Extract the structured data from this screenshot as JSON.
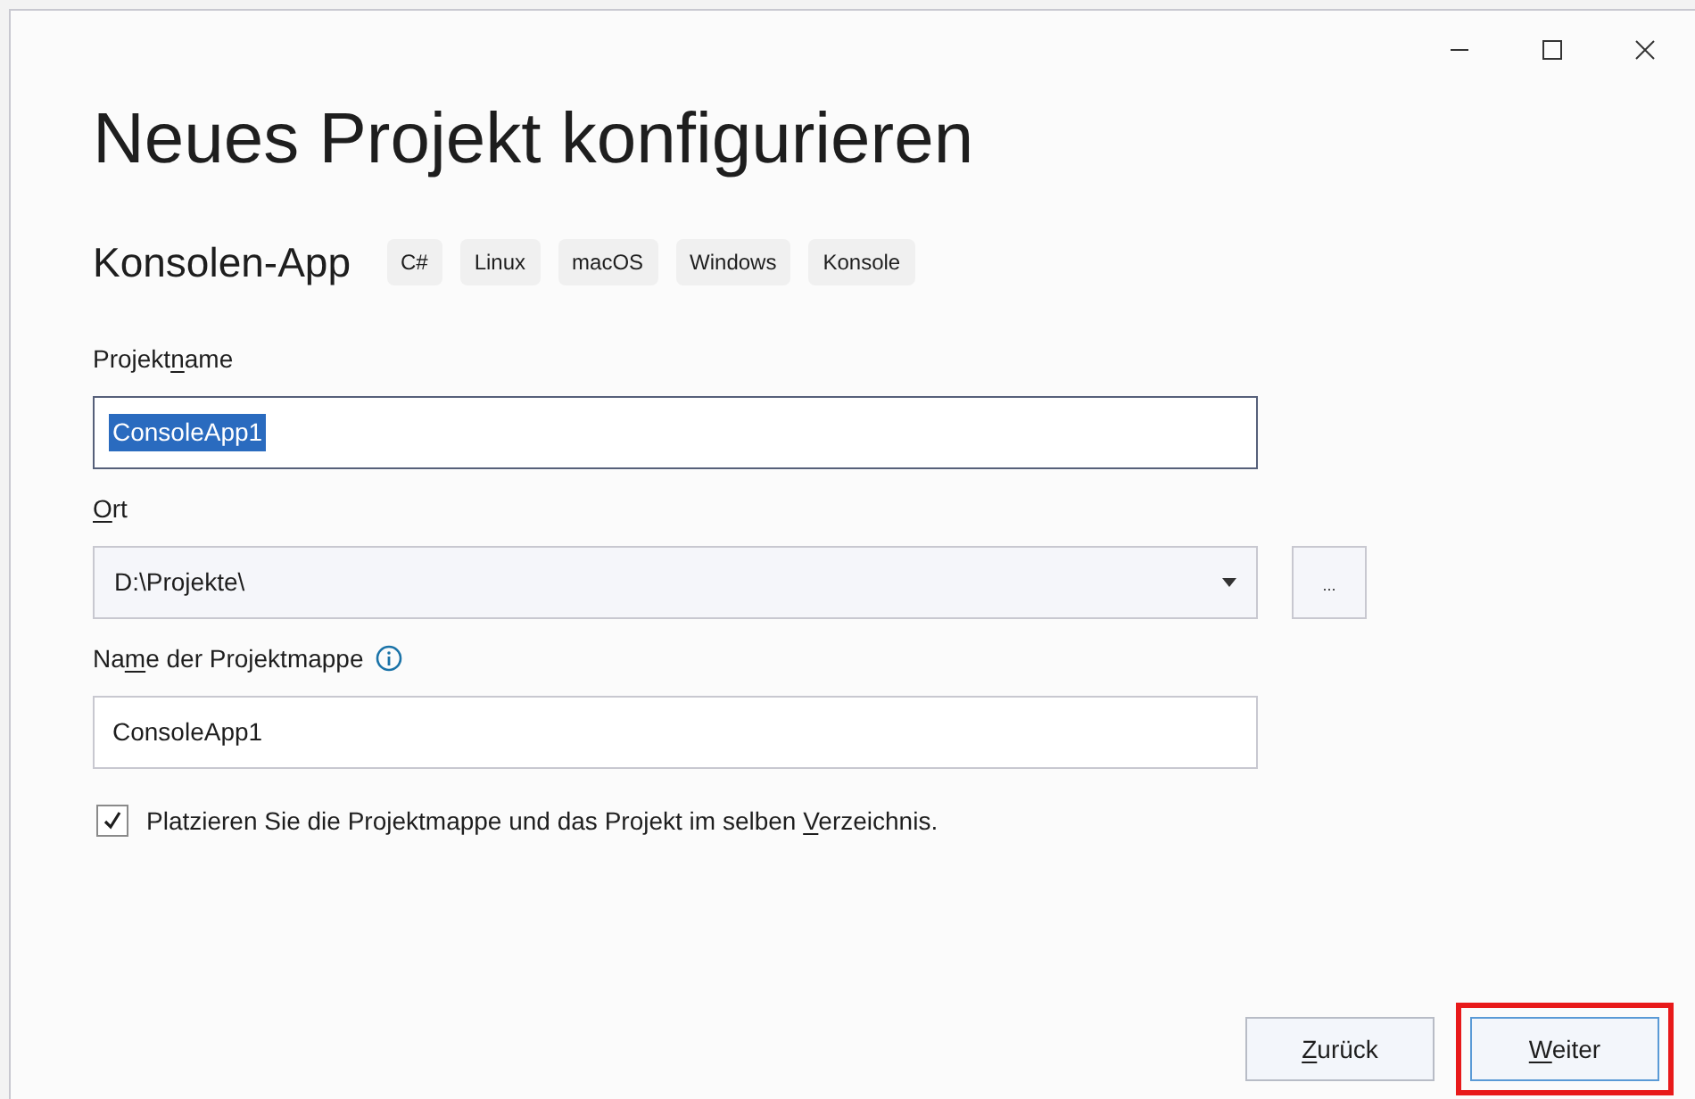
{
  "window": {
    "controls": [
      {
        "kind": "minimize"
      },
      {
        "kind": "maximize"
      },
      {
        "kind": "close"
      }
    ]
  },
  "title": "Neues Projekt konfigurieren",
  "template": {
    "name": "Konsolen-App",
    "tags": [
      "C#",
      "Linux",
      "macOS",
      "Windows",
      "Konsole"
    ]
  },
  "fields": [
    {
      "kind": "text",
      "label": {
        "before": "Projekt",
        "key": "n",
        "after": "ame"
      },
      "value": "ConsoleApp1",
      "text_selected": true,
      "info": false
    },
    {
      "kind": "combo",
      "label": {
        "key": "O",
        "after": "rt"
      },
      "value": "D:\\Projekte\\",
      "browse": "...",
      "info": false
    },
    {
      "kind": "text",
      "label": {
        "before": "Na",
        "key": "m",
        "after": "e der Projektmappe"
      },
      "value": "ConsoleApp1",
      "text_selected": false,
      "info": true
    }
  ],
  "checkbox": {
    "label": {
      "before": "Platzieren Sie die Projektmappe und das Projekt im selben ",
      "key": "V",
      "after": "erzeichnis."
    },
    "checked": true
  },
  "buttons": [
    {
      "label": {
        "key": "Z",
        "after": "urück"
      },
      "default": false,
      "highlighted": false
    },
    {
      "label": {
        "key": "W",
        "after": "eiter"
      },
      "default": true,
      "highlighted": true
    }
  ]
}
